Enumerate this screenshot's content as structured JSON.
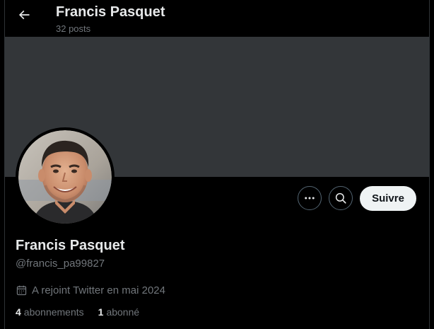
{
  "header": {
    "title": "Francis Pasquet",
    "post_count": "32 posts"
  },
  "profile": {
    "display_name": "Francis Pasquet",
    "handle": "@francis_pa99827",
    "joined": "A rejoint Twitter en mai 2024",
    "following": {
      "count": "4",
      "label": "abonnements"
    },
    "followers": {
      "count": "1",
      "label": "abonné"
    }
  },
  "actions": {
    "follow_label": "Suivre",
    "more_icon": "more-horizontal-icon",
    "search_icon": "search-icon"
  },
  "colors": {
    "background": "#000000",
    "banner": "#333639",
    "primary_text": "#e7e9ea",
    "secondary_text": "#71767b",
    "follow_button_bg": "#eff3f4",
    "border": "#536471"
  }
}
